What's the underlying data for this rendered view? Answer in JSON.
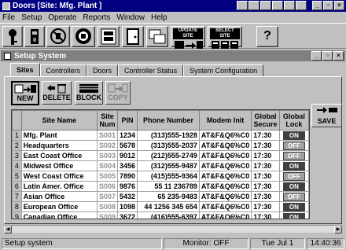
{
  "app": {
    "title": "Doors [Site: Mfg. Plant ]",
    "min": "_",
    "max": "▫",
    "close": "×"
  },
  "menu": [
    "File",
    "Setup",
    "Operate",
    "Reports",
    "Window",
    "Help"
  ],
  "toolbar": {
    "update_site_label": "UPDATE SITE",
    "select_site_label": "SELECT SITE",
    "help_glyph": "?"
  },
  "child": {
    "title": "Setup System"
  },
  "tabs": [
    "Sites",
    "Controllers",
    "Doors",
    "Controller Status",
    "System Configuration"
  ],
  "actions": {
    "new": "NEW",
    "delete": "DELETE",
    "block": "BLOCK",
    "copy": "COPY",
    "save": "SAVE"
  },
  "table": {
    "headers": {
      "name": "Site Name",
      "num": "Site Num",
      "pin": "PIN",
      "phone": "Phone Number",
      "modem": "Modem Init",
      "secure": "Global Secure",
      "lock": "Global Lock"
    },
    "rows": [
      {
        "n": "1",
        "name": "Mfg. Plant",
        "num": "S001",
        "pin": "1234",
        "phone": "(313)555-1928",
        "modem": "AT&F&Q6%C0",
        "secure": "17:30",
        "lock": "ON"
      },
      {
        "n": "2",
        "name": "Headquarters",
        "num": "S002",
        "pin": "5678",
        "phone": "(313)555-2037",
        "modem": "AT&F&Q6%C0",
        "secure": "17:30",
        "lock": "OFF"
      },
      {
        "n": "3",
        "name": "East Coast Office",
        "num": "S003",
        "pin": "9012",
        "phone": "(212)555-2749",
        "modem": "AT&F&Q6%C0",
        "secure": "17:30",
        "lock": "OFF"
      },
      {
        "n": "4",
        "name": "Midwest Office",
        "num": "S004",
        "pin": "3456",
        "phone": "(312)555-9487",
        "modem": "AT&F&Q6%C0",
        "secure": "17:30",
        "lock": "ON"
      },
      {
        "n": "5",
        "name": "West Coast Office",
        "num": "S005",
        "pin": "7890",
        "phone": "(415)555-9364",
        "modem": "AT&F&Q6%C0",
        "secure": "17:30",
        "lock": "OFF"
      },
      {
        "n": "6",
        "name": "Latin Amer. Office",
        "num": "S006",
        "pin": "9876",
        "phone": "55 11 236789",
        "modem": "AT&F&Q6%C0",
        "secure": "17:30",
        "lock": "ON"
      },
      {
        "n": "7",
        "name": "Asian Office",
        "num": "S007",
        "pin": "5432",
        "phone": "65 235-9483",
        "modem": "AT&F&Q6%C0",
        "secure": "17:30",
        "lock": "OFF"
      },
      {
        "n": "8",
        "name": "European Office",
        "num": "S008",
        "pin": "1098",
        "phone": "44 1256 345 654",
        "modem": "AT&F&Q6%C0",
        "secure": "17:30",
        "lock": "ON"
      },
      {
        "n": "9",
        "name": "Canadian Office",
        "num": "S009",
        "pin": "3672",
        "phone": "(416)555-6397",
        "modem": "AT&F&Q6%C0",
        "secure": "17:30",
        "lock": "ON"
      }
    ]
  },
  "status": {
    "message": "Setup system",
    "monitor": "Monitor: OFF",
    "date": "Tue Jul 1",
    "time": "14:40:36"
  }
}
